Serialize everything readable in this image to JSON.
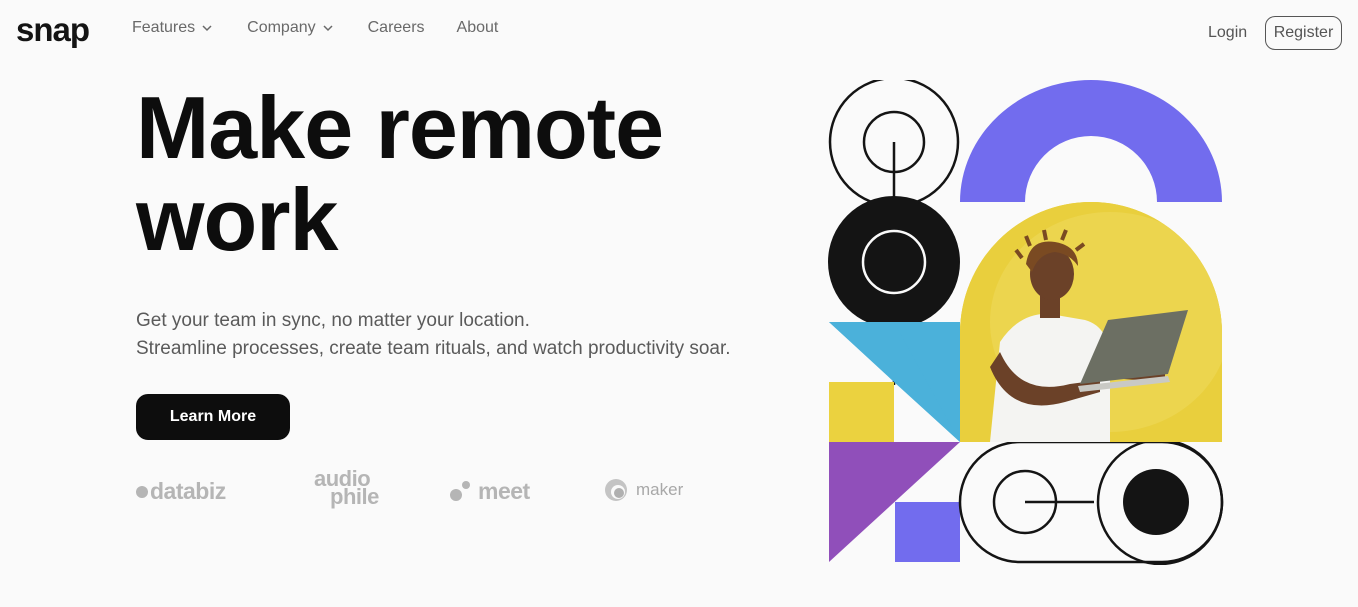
{
  "header": {
    "logo": "snap",
    "nav": [
      {
        "label": "Features",
        "has_dropdown": true
      },
      {
        "label": "Company",
        "has_dropdown": true
      },
      {
        "label": "Careers",
        "has_dropdown": false
      },
      {
        "label": "About",
        "has_dropdown": false
      }
    ],
    "login_label": "Login",
    "register_label": "Register"
  },
  "hero": {
    "headline_line1": "Make remote",
    "headline_line2": "work",
    "subtext_line1": "Get your team in sync, no matter your location.",
    "subtext_line2": "Streamline processes, create team rituals, and watch productivity soar.",
    "cta_label": "Learn More"
  },
  "clients": {
    "databiz": "databiz",
    "audiophile_line1": "audio",
    "audiophile_line2": "phile",
    "meet": "meet",
    "maker": "maker"
  },
  "colors": {
    "accent_purple": "#726CEE",
    "accent_yellow": "#EBD23F",
    "accent_blue": "#4BB1DA",
    "accent_violet": "#904FBA",
    "ink": "#141414"
  }
}
